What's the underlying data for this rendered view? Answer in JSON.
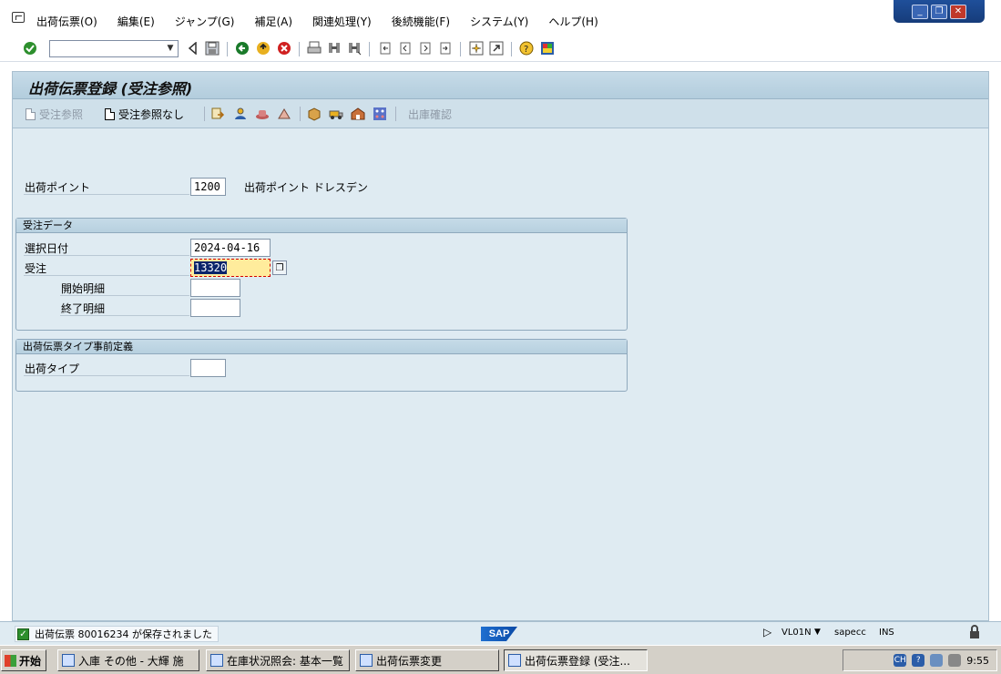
{
  "menubar": {
    "items": [
      "出荷伝票(O)",
      "編集(E)",
      "ジャンプ(G)",
      "補足(A)",
      "関連処理(Y)",
      "後続機能(F)",
      "システム(Y)",
      "ヘルプ(H)"
    ]
  },
  "window_controls": {
    "minimize": "_",
    "restore": "❐",
    "close": "✕"
  },
  "toolbar": {
    "command_field_value": "",
    "icons": [
      "enter-icon",
      "back-page-icon",
      "save-icon",
      "back-icon",
      "exit-icon",
      "cancel-icon",
      "print-icon",
      "find-icon",
      "find-next-icon",
      "first-page-icon",
      "prev-page-icon",
      "next-page-icon",
      "last-page-icon",
      "new-session-icon",
      "shortcut-icon",
      "help-icon",
      "customize-icon"
    ]
  },
  "screen": {
    "title": "出荷伝票登録 (受注参照)",
    "app_toolbar": {
      "ref_order": "受注参照",
      "no_ref_order": "受注参照なし",
      "confirm_goods_issue": "出庫確認"
    }
  },
  "form": {
    "shipping_point_label": "出荷ポイント",
    "shipping_point_value": "1200",
    "shipping_point_desc": "出荷ポイント ドレスデン",
    "order_group_title": "受注データ",
    "selection_date_label": "選択日付",
    "selection_date_value": "2024-04-16",
    "order_label": "受注",
    "order_value": "13320",
    "from_item_label": "開始明細",
    "from_item_value": "",
    "to_item_label": "終了明細",
    "to_item_value": "",
    "delivery_type_group_title": "出荷伝票タイプ事前定義",
    "delivery_type_label": "出荷タイプ",
    "delivery_type_value": ""
  },
  "statusbar": {
    "message": "出荷伝票 80016234 が保存されました",
    "logo": "SAP",
    "transaction": "VL01N",
    "server": "sapecc",
    "mode": "INS"
  },
  "taskbar": {
    "start": "开始",
    "tasks": [
      "入庫 その他 - 大輝 施",
      "在庫状況照会: 基本一覧",
      "出荷伝票変更",
      "出荷伝票登録 (受注..."
    ],
    "ime": "CH",
    "clock": "9:55"
  },
  "colors": {
    "client_bg": "#dfebf2",
    "title_bg": "#c6dbe8",
    "focus_field": "#ffec9c",
    "success": "#2d8f2d"
  }
}
